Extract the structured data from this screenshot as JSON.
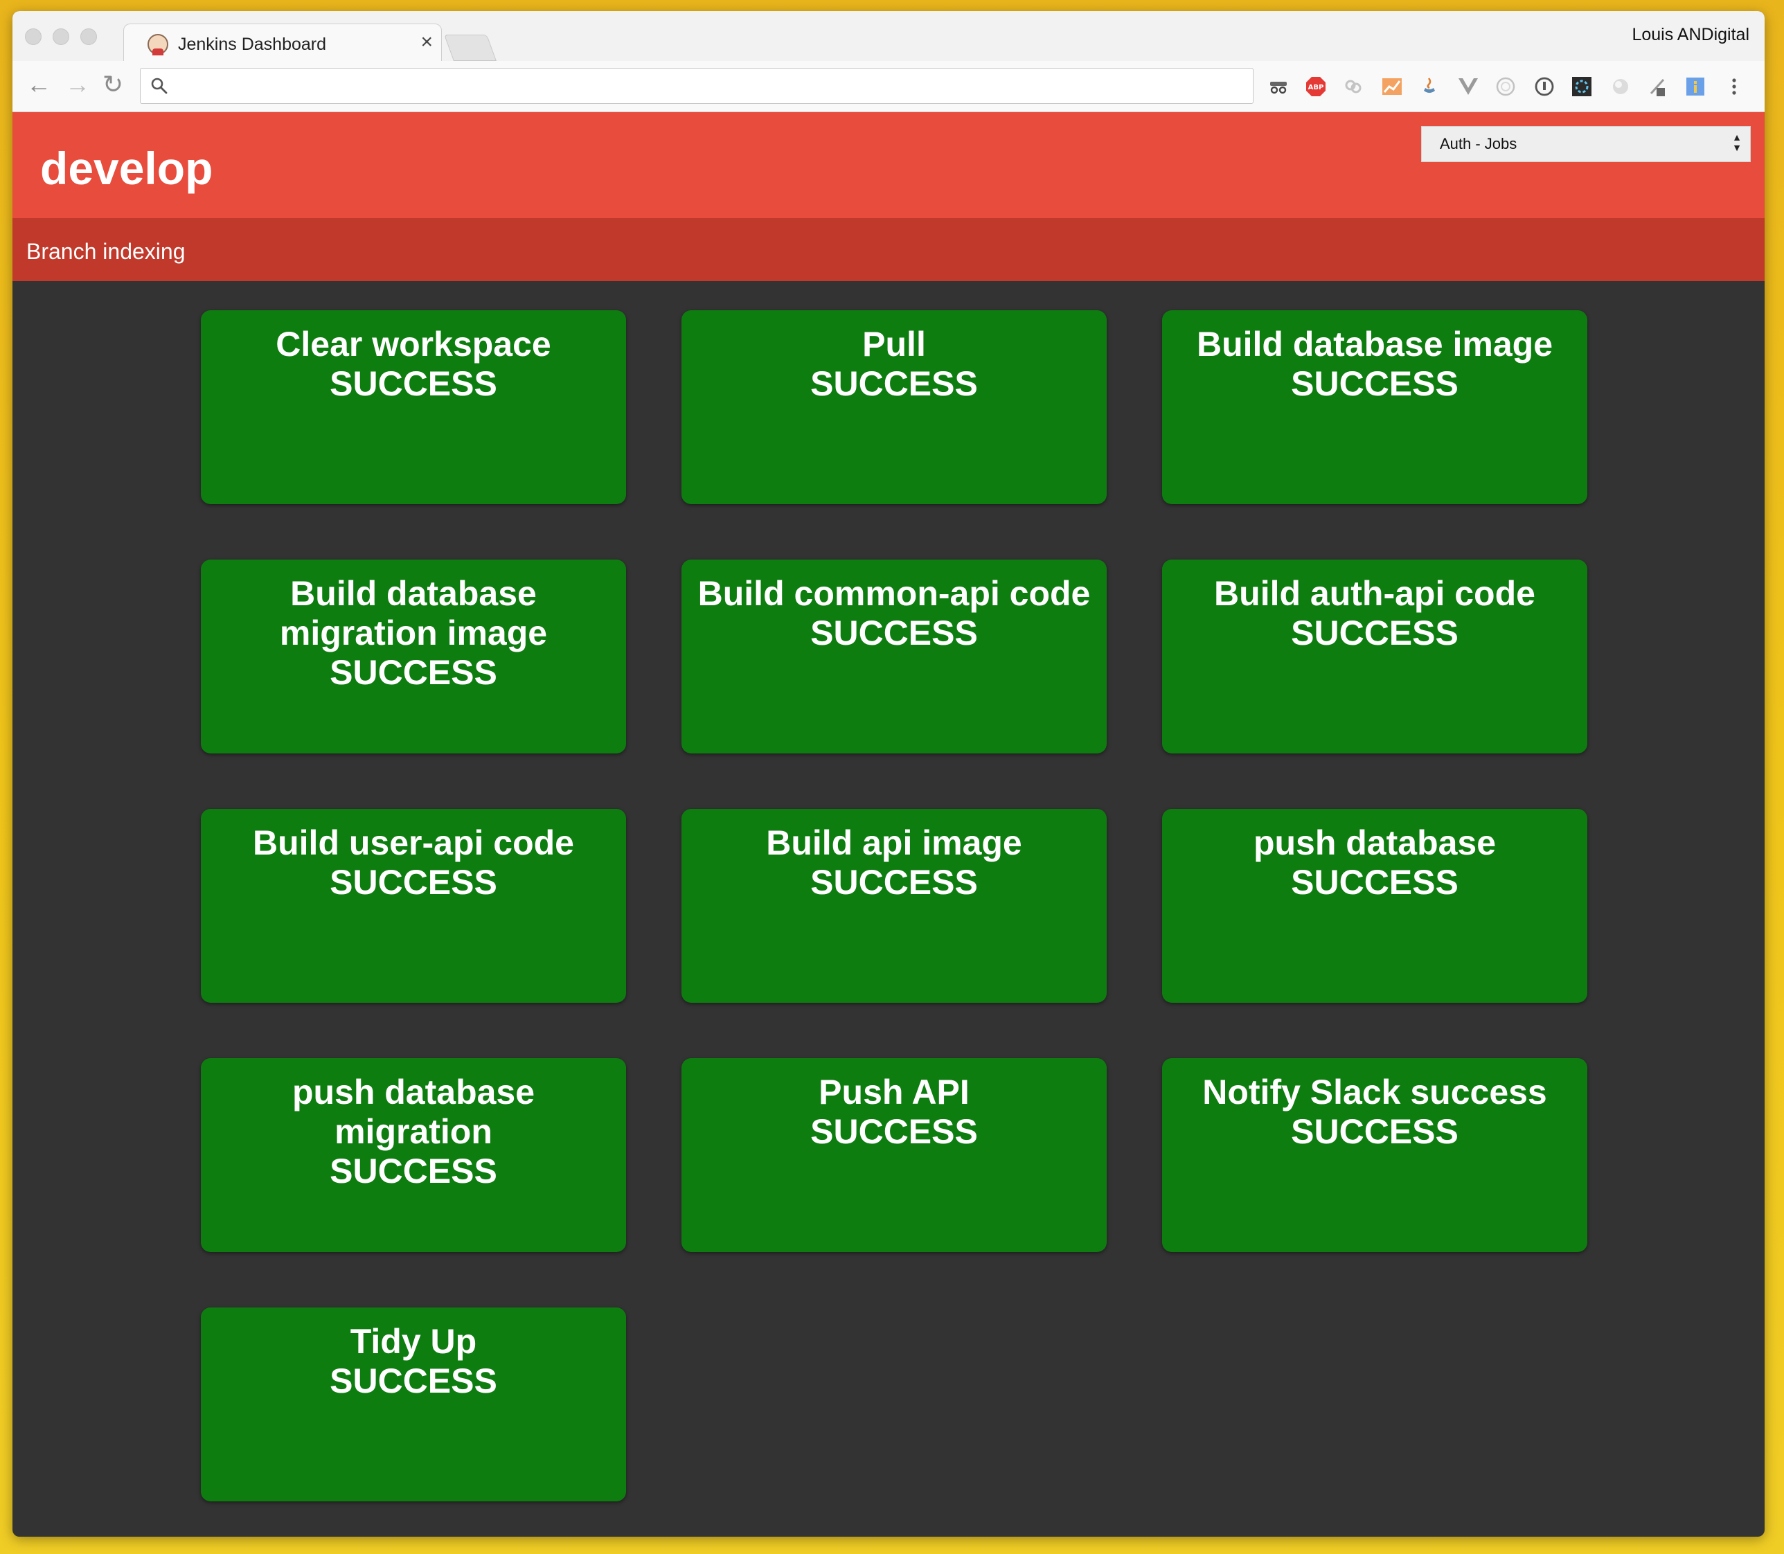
{
  "browser": {
    "tab_title": "Jenkins Dashboard",
    "tab_close": "×",
    "profile_name": "Louis ANDigital",
    "address": "",
    "nav": {
      "back": "←",
      "forward": "→",
      "reload": "↻"
    }
  },
  "header": {
    "title": "develop",
    "job_select_value": "Auth - Jobs",
    "accent_color": "#e74c3c"
  },
  "subheader": {
    "text": "Branch indexing",
    "color": "#c0392b"
  },
  "stages": [
    {
      "name": "Clear workspace",
      "status": "SUCCESS"
    },
    {
      "name": "Pull",
      "status": "SUCCESS"
    },
    {
      "name": "Build database image",
      "status": "SUCCESS"
    },
    {
      "name": "Build database migration image",
      "status": "SUCCESS"
    },
    {
      "name": "Build common-api code",
      "status": "SUCCESS"
    },
    {
      "name": "Build auth-api code",
      "status": "SUCCESS"
    },
    {
      "name": "Build user-api code",
      "status": "SUCCESS"
    },
    {
      "name": "Build api image",
      "status": "SUCCESS"
    },
    {
      "name": "push database",
      "status": "SUCCESS"
    },
    {
      "name": "push database migration",
      "status": "SUCCESS"
    },
    {
      "name": "Push API",
      "status": "SUCCESS"
    },
    {
      "name": "Notify Slack success",
      "status": "SUCCESS"
    },
    {
      "name": "Tidy Up",
      "status": "SUCCESS"
    }
  ],
  "colors": {
    "success": "#0e7d10",
    "background": "#333333"
  }
}
